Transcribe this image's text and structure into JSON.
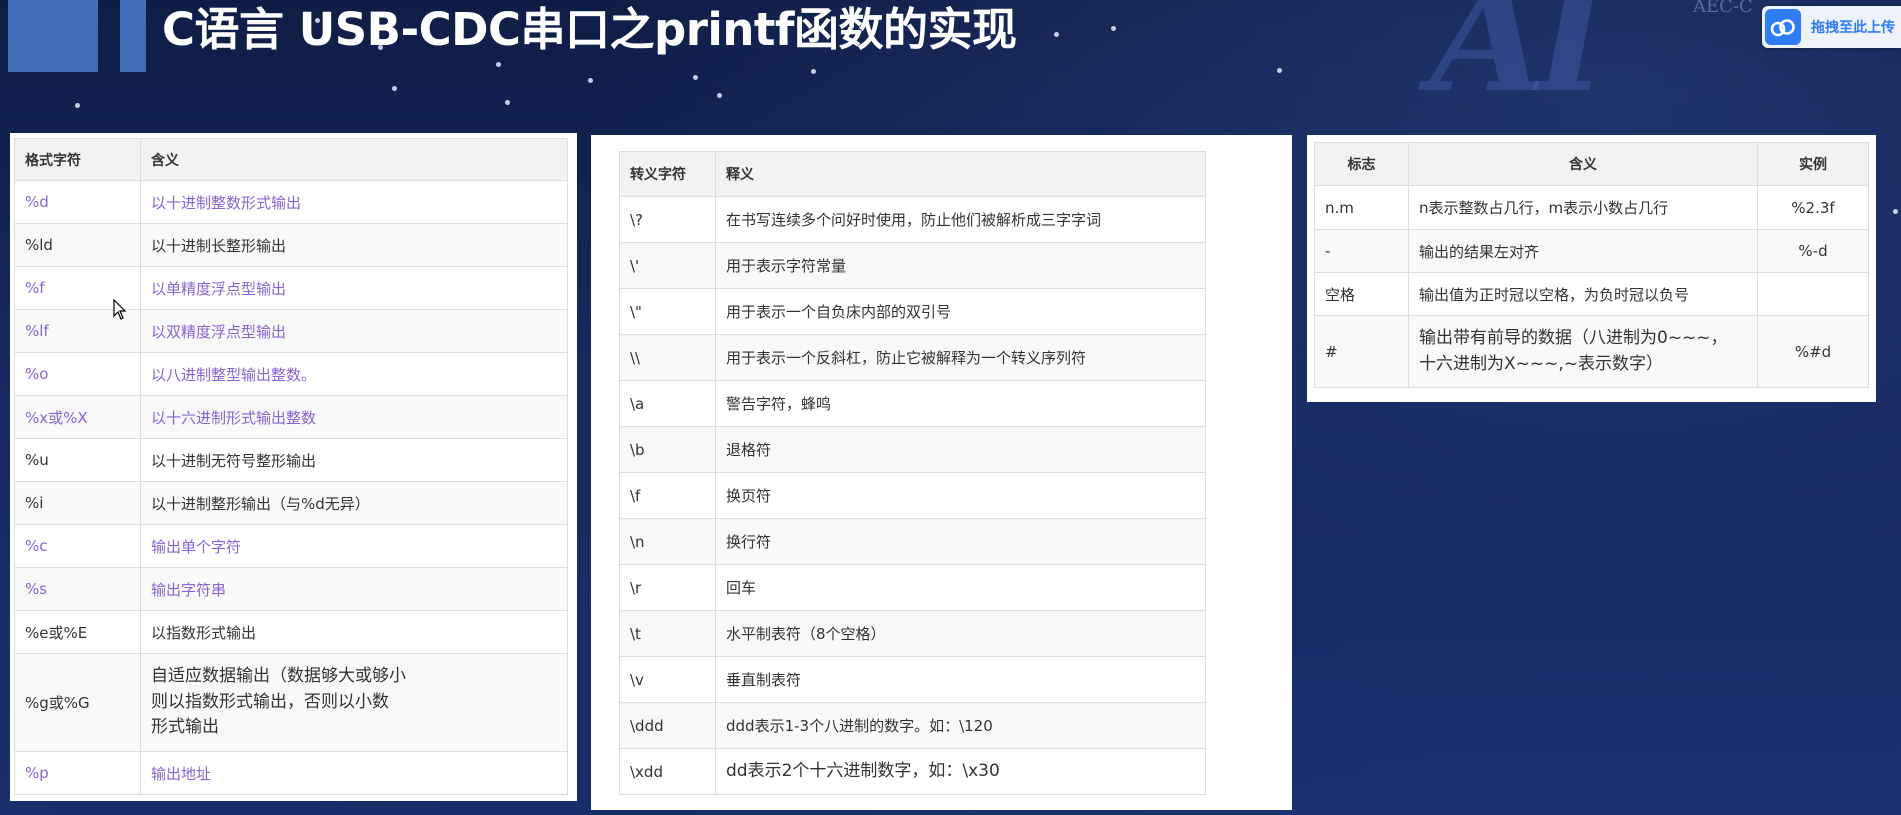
{
  "slide": {
    "title": "C语言 USB-CDC串口之printf函数的实现",
    "watermark": "AI",
    "watermark_small": "AEC-C"
  },
  "upload_button": {
    "label": "拖拽至此上传",
    "icon": "cloud-icon",
    "accent": "#2f7cf6"
  },
  "format_table": {
    "headers": [
      "格式字符",
      "含义"
    ],
    "rows": [
      {
        "key": "%d",
        "meaning": "以十进制整数形式输出",
        "link": true
      },
      {
        "key": "%ld",
        "meaning": "以十进制长整形输出",
        "link": false
      },
      {
        "key": "%f",
        "meaning": "以单精度浮点型输出",
        "link": true
      },
      {
        "key": "%lf",
        "meaning": "以双精度浮点型输出",
        "link": true
      },
      {
        "key": "%o",
        "meaning": "以八进制整型输出整数。",
        "link": true
      },
      {
        "key": "%x或%X",
        "meaning": "以十六进制形式输出整数",
        "link": true
      },
      {
        "key": "%u",
        "meaning": "以十进制无符号整形输出",
        "link": false
      },
      {
        "key": "%i",
        "meaning": "以十进制整形输出（与%d无异）",
        "link": false
      },
      {
        "key": "%c",
        "meaning": "输出单个字符",
        "link": true
      },
      {
        "key": "%s",
        "meaning": "输出字符串",
        "link": true
      },
      {
        "key": "%e或%E",
        "meaning": "以指数形式输出",
        "link": false
      },
      {
        "key": "%g或%G",
        "meaning": "自适应数据输出（数据够大或够小\n则以指数形式输出，否则以小数\n形式输出",
        "link": false
      },
      {
        "key": "%p",
        "meaning": "输出地址",
        "link": true
      }
    ]
  },
  "escape_table": {
    "headers": [
      "转义字符",
      "释义"
    ],
    "rows": [
      {
        "key": "\\?",
        "meaning": "在书写连续多个问好时使用，防止他们被解析成三字字词"
      },
      {
        "key": "\\'",
        "meaning": "用于表示字符常量"
      },
      {
        "key": "\\\"",
        "meaning": "用于表示一个自负床内部的双引号"
      },
      {
        "key": "\\\\",
        "meaning": "用于表示一个反斜杠，防止它被解释为一个转义序列符"
      },
      {
        "key": "\\a",
        "meaning": "警告字符，蜂鸣"
      },
      {
        "key": "\\b",
        "meaning": "退格符"
      },
      {
        "key": "\\f",
        "meaning": "换页符"
      },
      {
        "key": "\\n",
        "meaning": "换行符"
      },
      {
        "key": "\\r",
        "meaning": "回车"
      },
      {
        "key": "\\t",
        "meaning": "水平制表符（8个空格）"
      },
      {
        "key": "\\v",
        "meaning": "垂直制表符"
      },
      {
        "key": "\\ddd",
        "meaning": "ddd表示1-3个八进制的数字。如：\\120"
      },
      {
        "key": "\\xdd",
        "meaning": "dd表示2个十六进制数字，如：\\x30"
      }
    ]
  },
  "flag_table": {
    "headers": [
      "标志",
      "含义",
      "实例"
    ],
    "rows": [
      {
        "flag": "n.m",
        "meaning": "n表示整数占几行，m表示小数占几行",
        "example": "%2.3f"
      },
      {
        "flag": "-",
        "meaning": "输出的结果左对齐",
        "example": "%-d"
      },
      {
        "flag": "空格",
        "meaning": "输出值为正时冠以空格，为负时冠以负号",
        "example": ""
      },
      {
        "flag": "#",
        "meaning": "输出带有前导的数据（八进制为0~~~，\n十六进制为X~~~,~表示数字）",
        "example": "%#d"
      }
    ]
  }
}
